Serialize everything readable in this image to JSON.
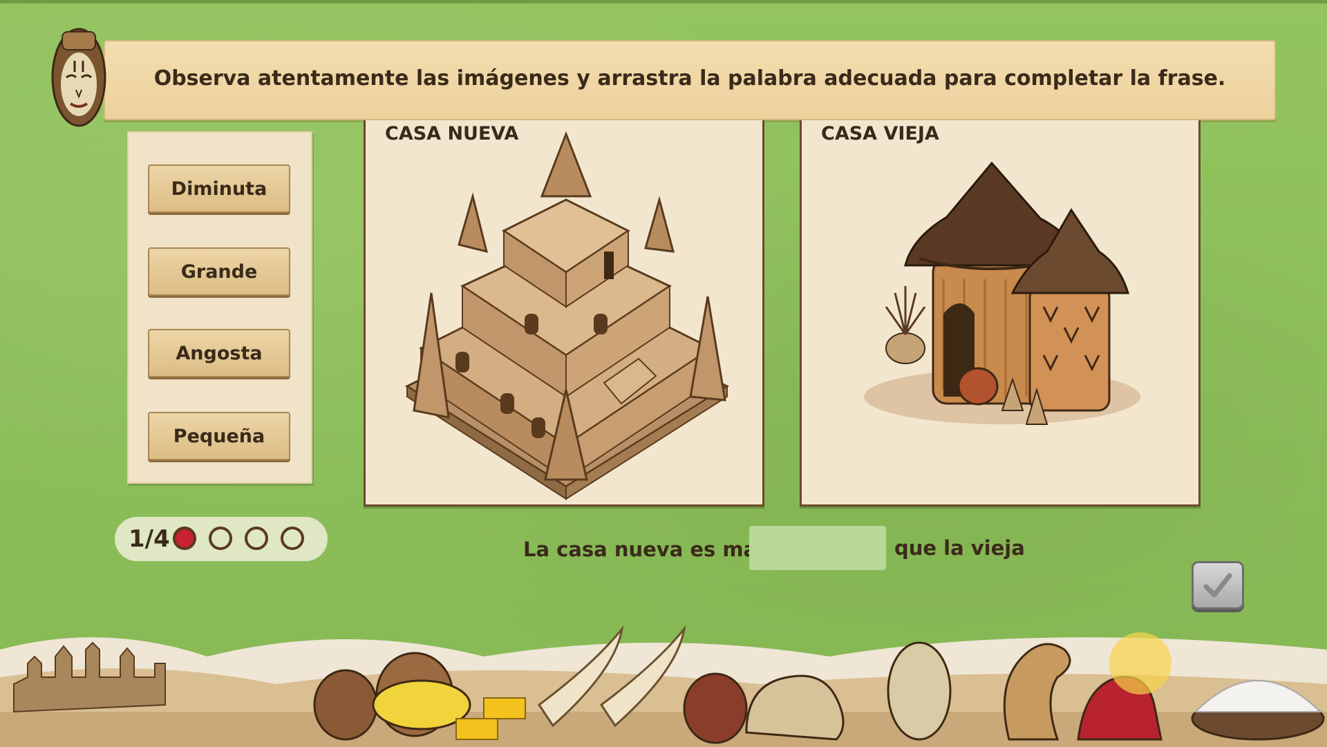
{
  "instruction": "Observa atentamente las imágenes y arrastra la palabra adecuada para completar la frase.",
  "word_options": [
    "Diminuta",
    "Grande",
    "Angosta",
    "Pequeña"
  ],
  "cards": [
    {
      "title": "CASA NUEVA",
      "image": "mud-brick-temple-illustration"
    },
    {
      "title": "CASA VIEJA",
      "image": "thatched-huts-illustration"
    }
  ],
  "progress": {
    "label": "1/4",
    "current": 1,
    "total": 4
  },
  "sentence": {
    "before": "La casa nueva es mas",
    "after": "que la vieja",
    "answer": ""
  },
  "check_button": {
    "icon": "checkmark-icon",
    "state": "disabled"
  },
  "colors": {
    "active_dot": "#c62232",
    "drop_zone": "#b8d996",
    "banner": "#f0d7a6"
  }
}
